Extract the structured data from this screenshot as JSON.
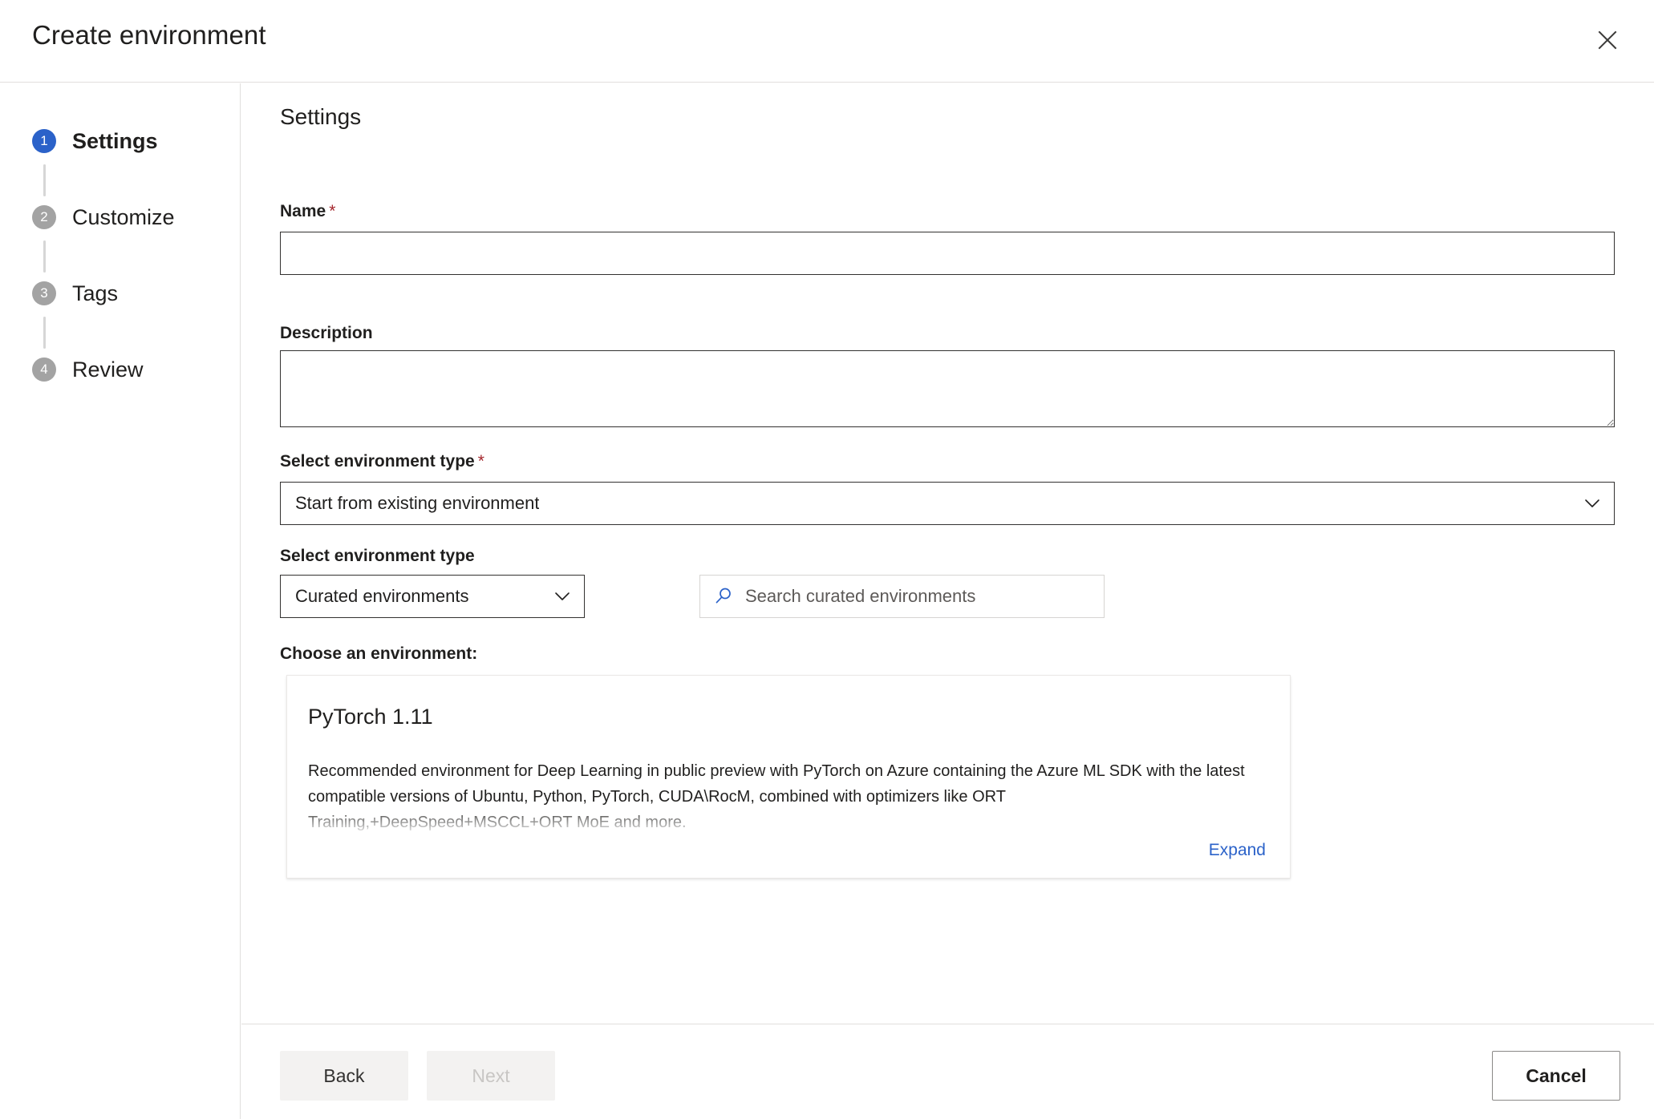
{
  "dialog": {
    "title": "Create environment",
    "close_icon": "close-icon"
  },
  "steps": [
    {
      "number": "1",
      "label": "Settings",
      "state": "active"
    },
    {
      "number": "2",
      "label": "Customize",
      "state": "inactive"
    },
    {
      "number": "3",
      "label": "Tags",
      "state": "inactive"
    },
    {
      "number": "4",
      "label": "Review",
      "state": "inactive"
    }
  ],
  "main": {
    "section_title": "Settings",
    "name": {
      "label": "Name",
      "required_marker": "*",
      "value": "",
      "placeholder": ""
    },
    "description": {
      "label": "Description",
      "value": "",
      "placeholder": ""
    },
    "environment_type": {
      "label": "Select environment type",
      "required_marker": "*",
      "selected": "Start from existing environment",
      "chevron_icon": "chevron-down-icon"
    },
    "environment_source": {
      "label": "Select environment type",
      "selected": "Curated environments",
      "chevron_icon": "chevron-down-icon"
    },
    "search": {
      "placeholder": "Search curated environments",
      "icon": "search-icon",
      "value": ""
    },
    "choose_label": "Choose an environment:",
    "environment_card": {
      "title": "PyTorch 1.11",
      "description": "Recommended environment for Deep Learning in public preview with PyTorch on Azure containing the Azure ML SDK with the latest compatible versions of Ubuntu, Python, PyTorch, CUDA\\RocM, combined with optimizers like ORT Training,+DeepSpeed+MSCCL+ORT MoE and more.",
      "expand_label": "Expand"
    }
  },
  "footer": {
    "back_label": "Back",
    "next_label": "Next",
    "cancel_label": "Cancel"
  },
  "colors": {
    "accent": "#2b62c9",
    "required": "#a4262c",
    "link": "#2b62c9",
    "step_inactive": "#a3a3a3",
    "border_strong": "#323130",
    "border_light": "#e1dfdd"
  }
}
